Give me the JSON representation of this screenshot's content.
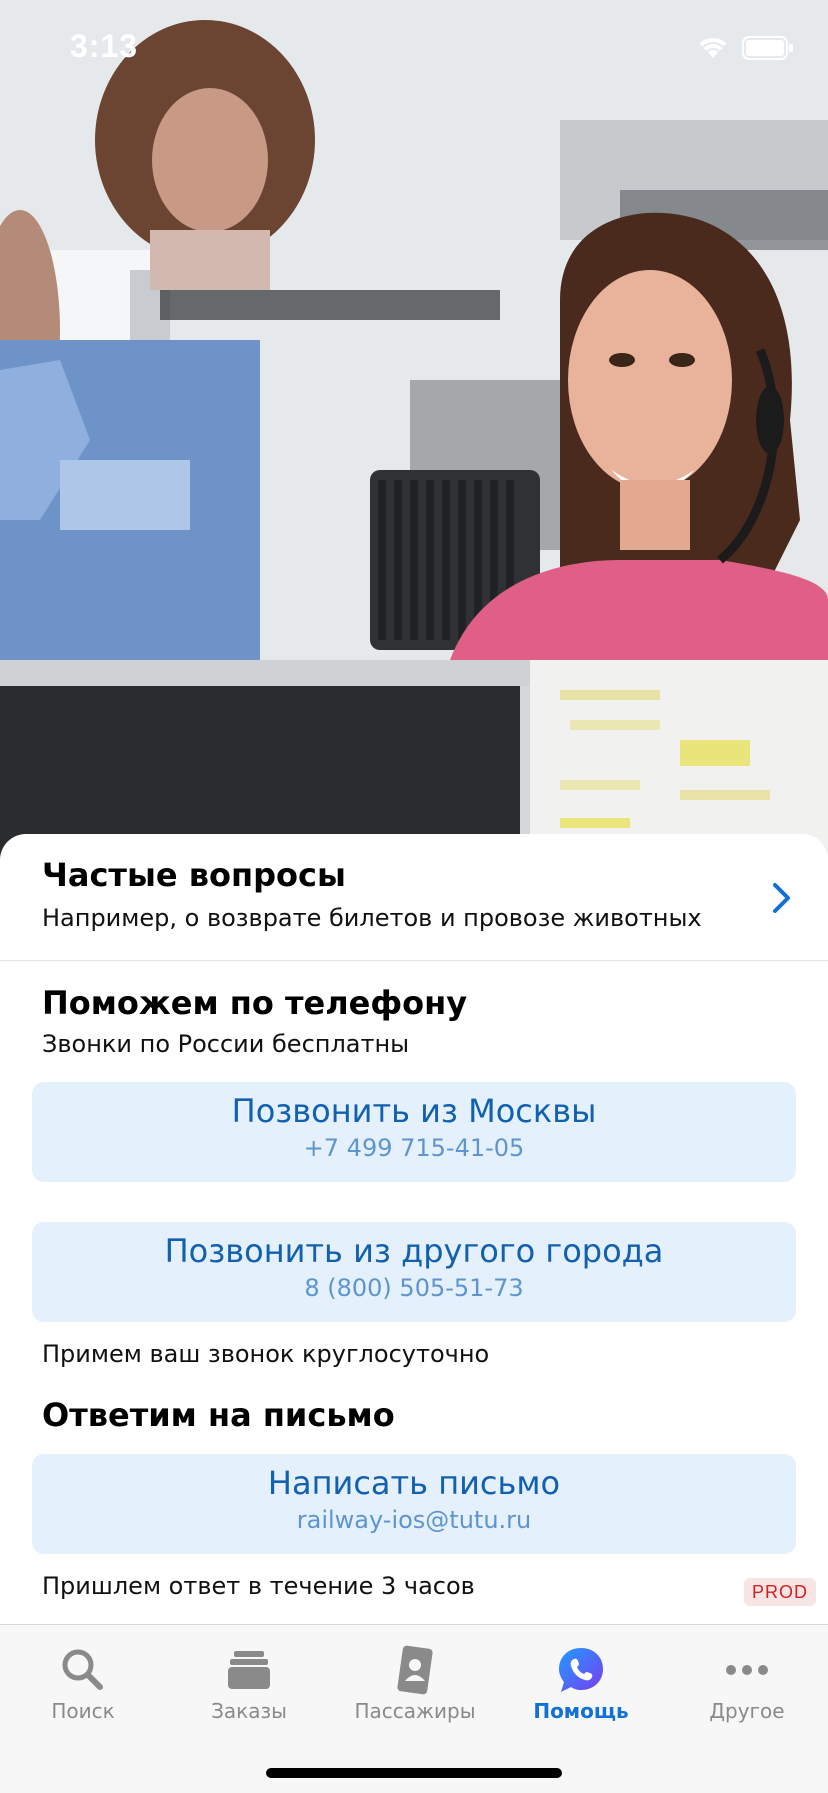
{
  "status_bar": {
    "time": "3:13"
  },
  "faq": {
    "title": "Частые вопросы",
    "subtitle": "Например, о возврате билетов и провозе животных"
  },
  "phone_section": {
    "title": "Поможем по телефону",
    "subtitle": "Звонки по России бесплатны",
    "buttons": [
      {
        "label": "Позвонить из Москвы",
        "number": "+7 499 715-41-05"
      },
      {
        "label": "Позвонить из другого города",
        "number": "8 (800) 505-51-73"
      }
    ],
    "note": "Примем ваш звонок круглосуточно"
  },
  "email_section": {
    "title": "Ответим на письмо",
    "button": {
      "label": "Написать письмо",
      "email": "railway-ios@tutu.ru"
    },
    "note": "Пришлем ответ в течение 3 часов"
  },
  "env_badge": "PROD",
  "tabbar": {
    "items": [
      {
        "label": "Поиск",
        "icon": "search-icon",
        "active": false
      },
      {
        "label": "Заказы",
        "icon": "orders-icon",
        "active": false
      },
      {
        "label": "Пассажиры",
        "icon": "passengers-icon",
        "active": false
      },
      {
        "label": "Помощь",
        "icon": "help-chat-icon",
        "active": true
      },
      {
        "label": "Другое",
        "icon": "more-icon",
        "active": false
      }
    ]
  },
  "colors": {
    "accent": "#1270d6",
    "button_bg": "#e4f0fb",
    "button_text": "#1260b0",
    "button_subtext": "#5f95cf",
    "badge_text": "#d42020"
  }
}
